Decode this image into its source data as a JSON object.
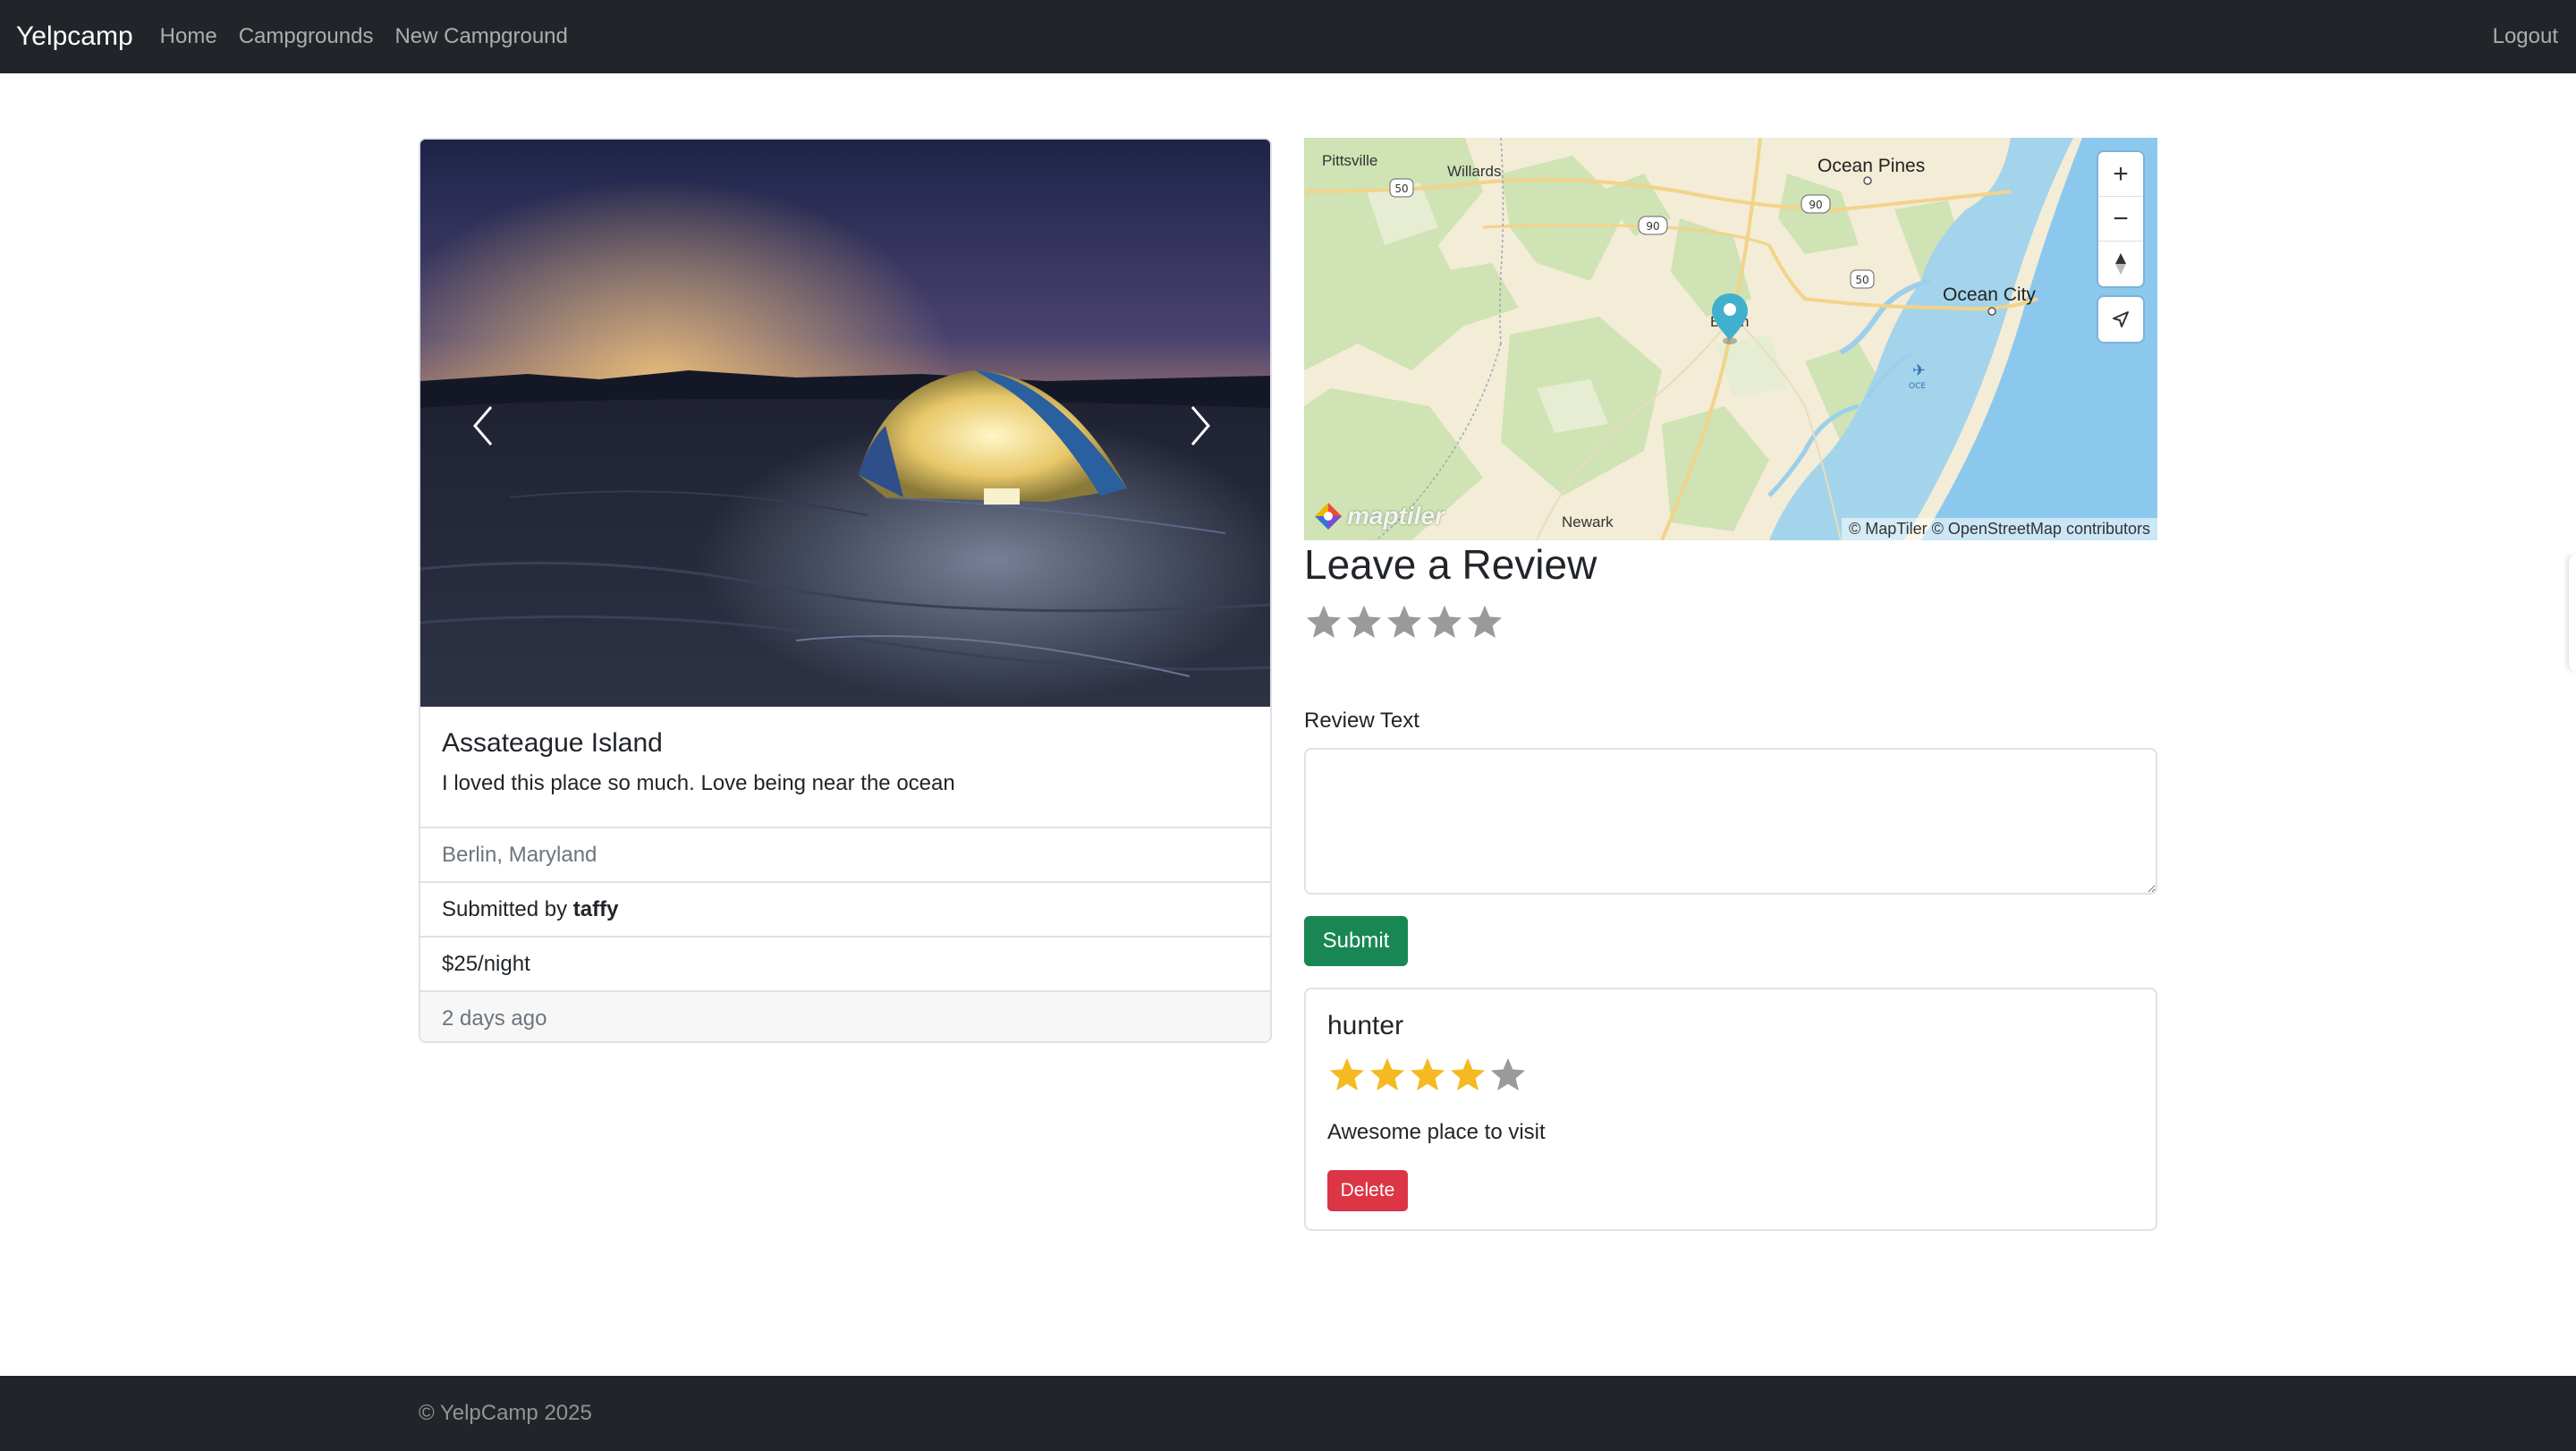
{
  "navbar": {
    "brand": "Yelpcamp",
    "links": [
      "Home",
      "Campgrounds",
      "New Campground"
    ],
    "logout": "Logout"
  },
  "campground": {
    "title": "Assateague Island",
    "description": "I loved this place so much. Love being near the ocean",
    "location": "Berlin, Maryland",
    "submitted_prefix": "Submitted by ",
    "author": "taffy",
    "price": "$25/night",
    "posted": "2 days ago"
  },
  "map": {
    "labels": [
      "Pittsville",
      "Willards",
      "Ocean Pines",
      "Ocean City",
      "Berlin",
      "Newark"
    ],
    "route_shields": [
      "50",
      "90",
      "90",
      "50"
    ],
    "attribution": "© MapTiler © OpenStreetMap contributors",
    "logo": "maptiler",
    "marker_color": "#3fb1ce",
    "airport_label": "OCE",
    "controls": [
      "plus-icon",
      "minus-icon",
      "compass-icon",
      "geolocate-icon"
    ]
  },
  "review_form": {
    "heading": "Leave a Review",
    "rating": 0,
    "rating_max": 5,
    "text_label": "Review Text",
    "text_value": "",
    "submit_label": "Submit"
  },
  "reviews": [
    {
      "user": "hunter",
      "rating": 4,
      "rating_max": 5,
      "body": "Awesome place to visit",
      "delete_label": "Delete"
    }
  ],
  "footer": {
    "text": "© YelpCamp 2025"
  },
  "colors": {
    "navbar": "#212529",
    "submit": "#198754",
    "delete": "#dc3545",
    "star_filled": "#f5b921",
    "star_empty": "#9a9a9a"
  }
}
